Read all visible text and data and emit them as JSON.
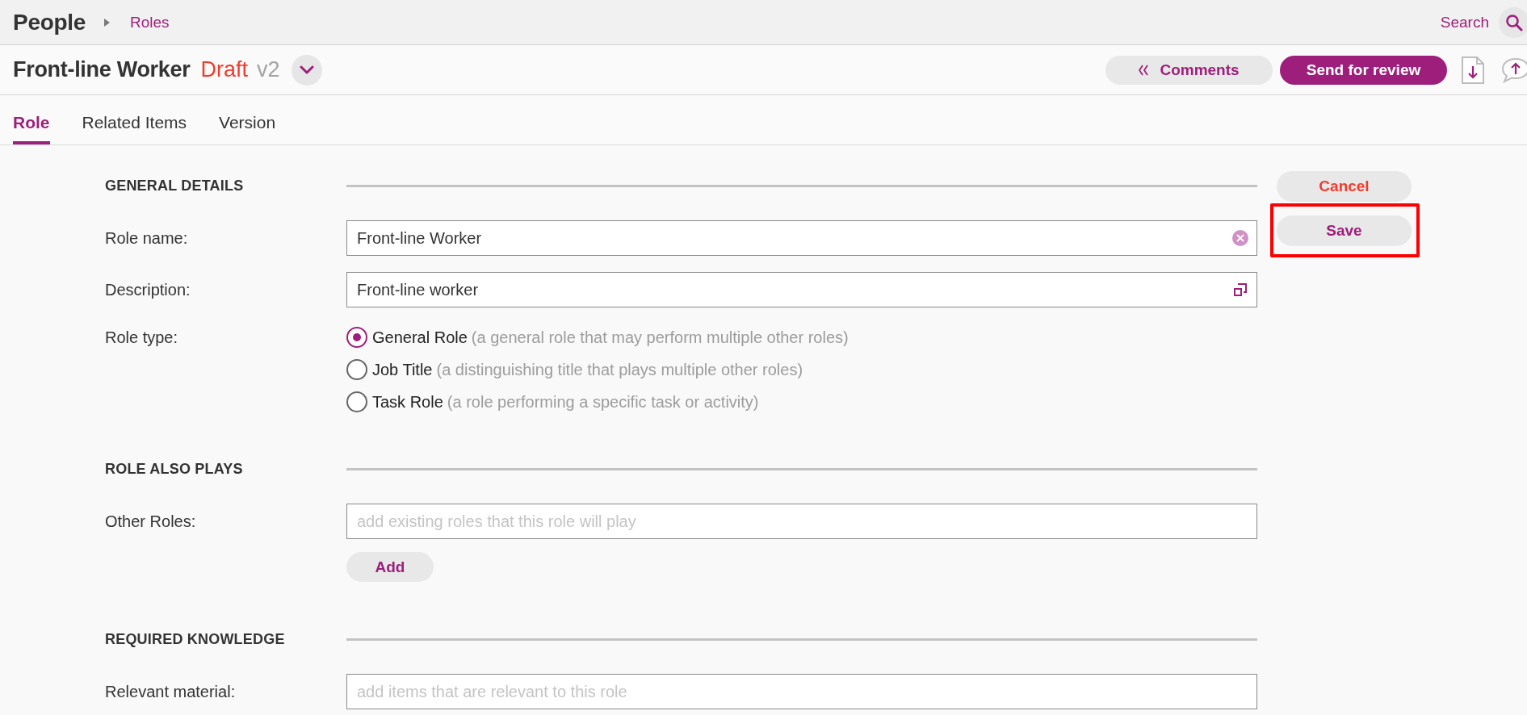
{
  "header": {
    "title": "People",
    "breadcrumb": [
      {
        "label": "Roles"
      }
    ],
    "search_label": "Search"
  },
  "document": {
    "title": "Front-line Worker",
    "status": "Draft",
    "version": "v2",
    "actions": [
      {
        "kind": "secondary",
        "label": "Comments"
      },
      {
        "kind": "primary",
        "label": "Send for review"
      }
    ]
  },
  "tabs": [
    {
      "label": "Role",
      "selected": true
    },
    {
      "label": "Related Items",
      "selected": false
    },
    {
      "label": "Version",
      "selected": false
    }
  ],
  "sections": [
    {
      "heading": "GENERAL DETAILS",
      "rows": [
        {
          "kind": "text",
          "label": "Role name:",
          "value": "Front-line Worker",
          "clearable": true
        },
        {
          "kind": "text",
          "label": "Description:",
          "value": "Front-line worker",
          "expandable": true
        },
        {
          "kind": "radio",
          "label": "Role type:",
          "options": [
            {
              "label": "General Role",
              "hint": "(a general role that may perform multiple other roles)",
              "selected": true
            },
            {
              "label": "Job Title",
              "hint": "(a distinguishing title that plays multiple other roles)",
              "selected": false
            },
            {
              "label": "Task Role",
              "hint": "(a role performing a specific task or activity)",
              "selected": false
            }
          ]
        }
      ]
    },
    {
      "heading": "ROLE ALSO PLAYS",
      "rows": [
        {
          "kind": "lookup",
          "label": "Other Roles:",
          "placeholder": "add existing roles that this role will play",
          "button": "Add"
        }
      ]
    },
    {
      "heading": "REQUIRED KNOWLEDGE",
      "rows": [
        {
          "kind": "lookup",
          "label": "Relevant material:",
          "placeholder": "add items that are relevant to this role"
        }
      ]
    }
  ],
  "form_actions": [
    {
      "kind": "cancel",
      "label": "Cancel",
      "highlighted": false
    },
    {
      "kind": "save",
      "label": "Save",
      "highlighted": true
    }
  ]
}
